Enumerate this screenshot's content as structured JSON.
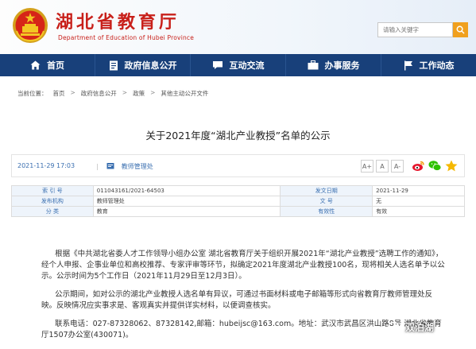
{
  "header": {
    "title": "湖北省教育厅",
    "subtitle": "Department of Education of Hubei Province",
    "search_placeholder": "请输入关键字"
  },
  "nav": {
    "items": [
      {
        "label": "首页",
        "icon": "home-icon"
      },
      {
        "label": "政府信息公开",
        "icon": "document-icon"
      },
      {
        "label": "互动交流",
        "icon": "chat-icon"
      },
      {
        "label": "办事服务",
        "icon": "briefcase-icon"
      },
      {
        "label": "工作动态",
        "icon": "flag-icon"
      }
    ]
  },
  "breadcrumb": {
    "prefix": "当前位置：",
    "items": [
      "首页",
      "政府信息公开",
      "政策",
      "其他主动公开文件"
    ],
    "separator": ">"
  },
  "article": {
    "title": "关于2021年度“湖北产业教授”名单的公示",
    "date": "2021-11-29 17:03",
    "source_sep": "|",
    "source": "教师管理处",
    "font_buttons": [
      "A+",
      "A",
      "A-"
    ]
  },
  "info_table": {
    "rows": [
      [
        {
          "label": "索 引 号",
          "value": "011043161/2021-64503"
        },
        {
          "label": "发文日期",
          "value": "2021-11-29"
        }
      ],
      [
        {
          "label": "发布机构",
          "value": "教师管理处"
        },
        {
          "label": "文  号",
          "value": "无"
        }
      ],
      [
        {
          "label": "分  类",
          "value": "教育"
        },
        {
          "label": "有效性",
          "value": "有效"
        }
      ]
    ]
  },
  "body": {
    "paragraphs": [
      "根据《中共湖北省委人才工作领导小组办公室 湖北省教育厅关于组织开展2021年“湖北产业教授”选聘工作的通知》，经个人申报、企事业单位和高校推荐、专家评审等环节，拟确定2021年度湖北产业教授100名，现将相关人选名单予以公示。公示时间为5个工作日（2021年11月29日至12月3日）。",
      "公示期间，如对公示的湖北产业教授人选名单有异议，可通过书面材料或电子邮箱等形式向省教育厅教师管理处反映。反映情况应实事求是、客观真实并提供详实材料，以便调查核实。",
      "联系电话：027-87328062、87328142,邮箱：hubeijsc@163.com。地址：武汉市武昌区洪山路8号 湖北省教育厅1507办公室(430071)。"
    ]
  },
  "watermark": {
    "text": "双泊湖"
  },
  "colors": {
    "brand_red": "#c8201a",
    "nav_blue": "#18407a",
    "link_blue": "#3a6fb0",
    "search_orange": "#f0a01e"
  }
}
